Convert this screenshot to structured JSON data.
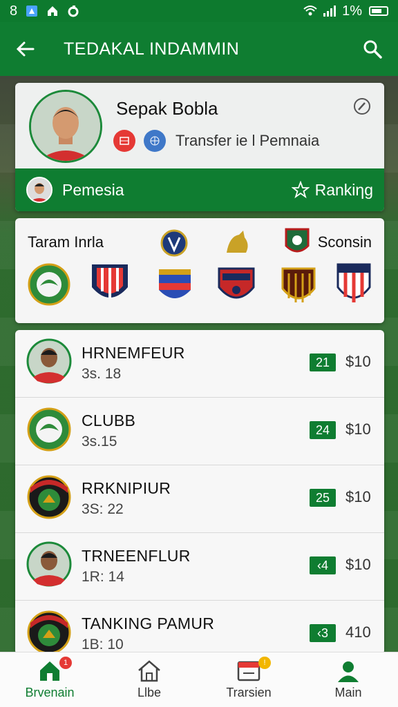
{
  "status_bar": {
    "time": "8",
    "battery_text": "1%",
    "icons": [
      "notification-icon",
      "home-icon",
      "sync-icon",
      "wifi-icon",
      "signal-icon",
      "battery-icon"
    ]
  },
  "app_bar": {
    "title": "TEDAKAL INDAMMIN",
    "back_icon": "arrow-left-icon",
    "search_icon": "search-icon"
  },
  "profile": {
    "name": "Sepak Bobla",
    "subtitle": "Transfer ie l Pemnaia",
    "strip_label": "Pemesia",
    "strip_right_label": "Rankiηg",
    "edit_icon": "edit-icon"
  },
  "teams": {
    "title": "Taram Inrla",
    "right_label": "Sconsin"
  },
  "list": [
    {
      "name": "HRNEMFEUR",
      "sub": "3s. 18",
      "badge": "21",
      "price": "$10",
      "avatar": "player"
    },
    {
      "name": "CLUBB",
      "sub": "3s.15",
      "badge": "24",
      "price": "$10",
      "avatar": "crest-green"
    },
    {
      "name": "RRKNIPIUR",
      "sub": "3S: 22",
      "badge": "25",
      "price": "$10",
      "avatar": "crest-red"
    },
    {
      "name": "TRNEENFLUR",
      "sub": "1R: 14",
      "badge": "‹4",
      "price": "$10",
      "avatar": "player"
    },
    {
      "name": "TANKING PAMUR",
      "sub": "1B: 10",
      "badge": "‹3",
      "price": "410",
      "avatar": "crest-red"
    }
  ],
  "bottom_nav": [
    {
      "label": "Brvenain",
      "icon": "home-icon",
      "active": true,
      "dot": "1"
    },
    {
      "label": "Llbe",
      "icon": "house-outline-icon",
      "active": false,
      "dot": ""
    },
    {
      "label": "Trarsien",
      "icon": "scoreboard-icon",
      "active": false,
      "dot": "!"
    },
    {
      "label": "Main",
      "icon": "profile-icon",
      "active": false,
      "dot": ""
    }
  ],
  "colors": {
    "primary": "#0f7d31",
    "badge_red": "#e53935",
    "badge_yellow": "#f2b600"
  }
}
